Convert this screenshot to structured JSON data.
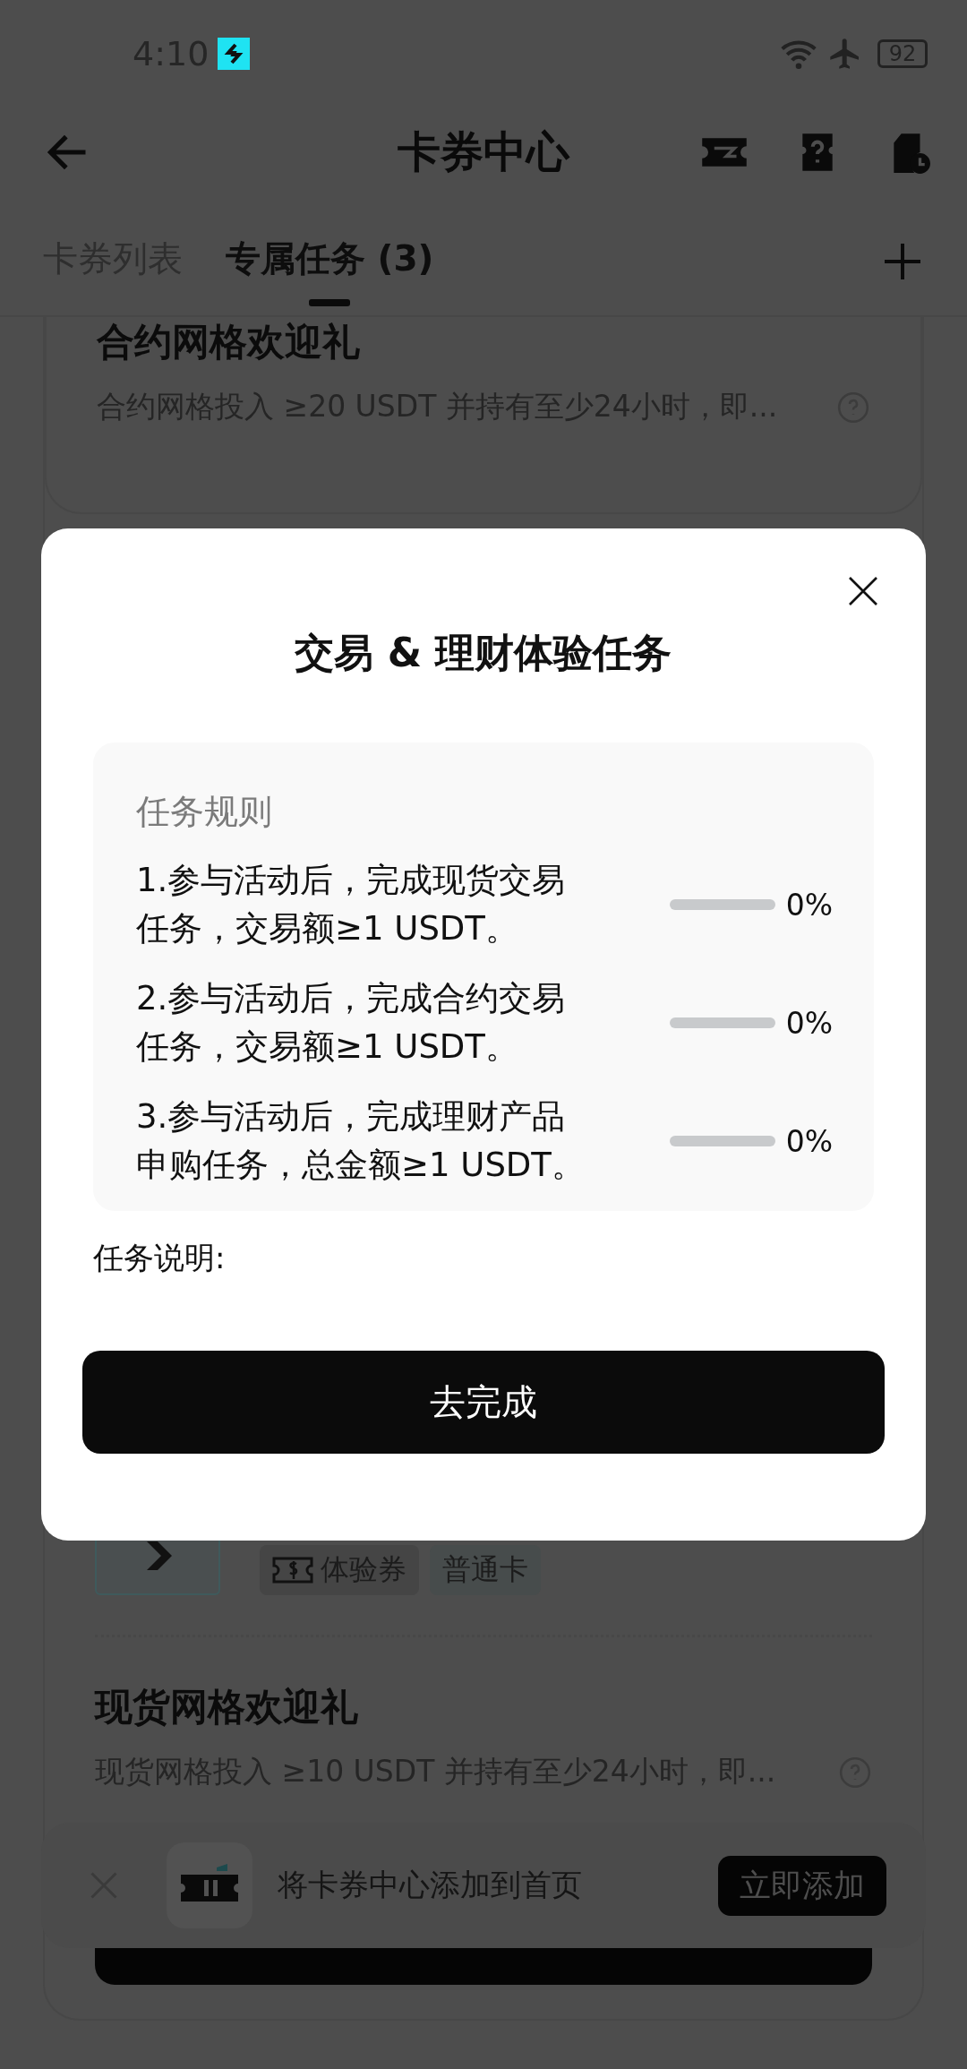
{
  "status_bar": {
    "time": "4:10",
    "battery": "92"
  },
  "header": {
    "title": "卡券中心"
  },
  "tabs": [
    {
      "label": "卡券列表",
      "selected": false
    },
    {
      "label": "专属任务 (3)",
      "selected": true
    }
  ],
  "cards": [
    {
      "title": "合约网格欢迎礼",
      "description": "合约网格投入 ≥20 USDT 并持有至少24小时，即..."
    },
    {
      "tags": [
        {
          "label": "体验券",
          "kind": "coupon"
        },
        {
          "label": "普通卡",
          "kind": "plain"
        }
      ]
    },
    {
      "title": "现货网格欢迎礼",
      "description": "现货网格投入 ≥10 USDT 并持有至少24小时，即..."
    }
  ],
  "modal": {
    "title": "交易 & 理财体验任务",
    "rules_heading": "任务规则",
    "rules": [
      {
        "text": "1.参与活动后，完成现货交易任务，交易额≥1 USDT。",
        "level": 0,
        "reading": "0%"
      },
      {
        "text": "2.参与活动后，完成合约交易任务，交易额≥1 USDT。",
        "level": 0,
        "reading": "0%"
      },
      {
        "text": "3.参与活动后，完成理财产品申购任务，总金额≥1 USDT。",
        "level": 0,
        "reading": "0%"
      }
    ],
    "note_label": "任务说明:",
    "button": "去完成"
  },
  "banner": {
    "text": "将卡券中心添加到首页",
    "button": "立即添加"
  }
}
